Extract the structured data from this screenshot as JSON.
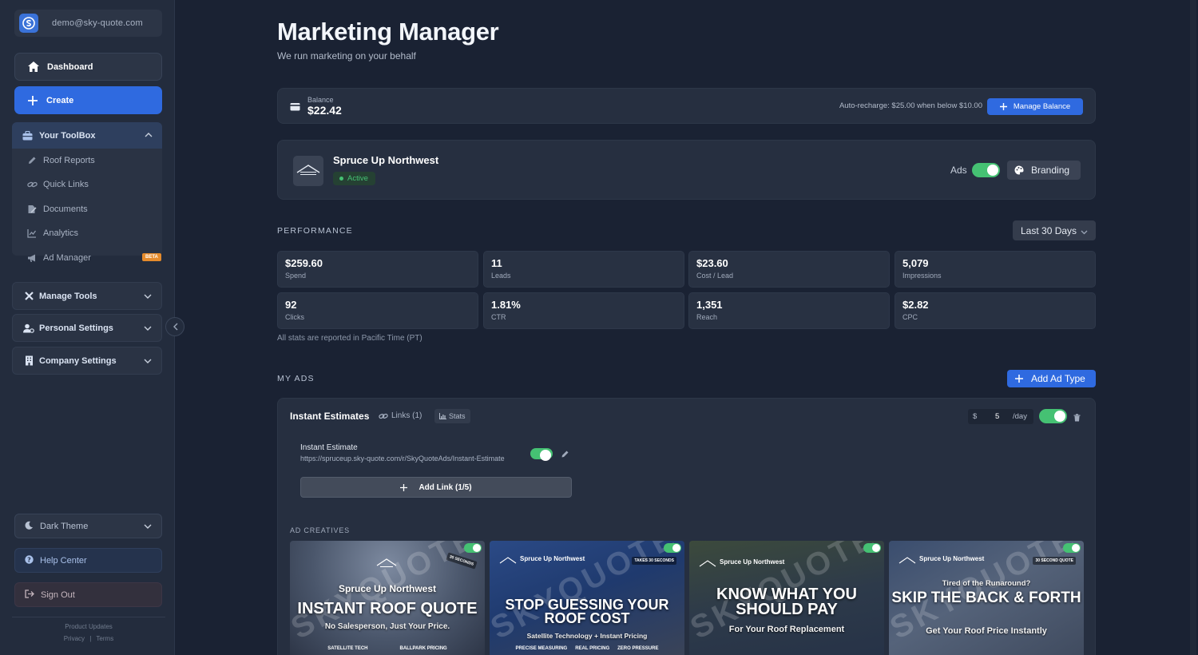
{
  "account": {
    "email": "demo@sky-quote.com",
    "logo_letter": "S"
  },
  "nav": {
    "dashboard": "Dashboard",
    "create": "Create"
  },
  "toolbox": {
    "title": "Your ToolBox",
    "items": [
      {
        "label": "Roof Reports",
        "icon": "pencil-icon"
      },
      {
        "label": "Quick Links",
        "icon": "link-icon"
      },
      {
        "label": "Documents",
        "icon": "document-icon"
      },
      {
        "label": "Analytics",
        "icon": "chart-icon"
      },
      {
        "label": "Ad Manager",
        "icon": "megaphone-icon"
      }
    ],
    "beta": "BETA"
  },
  "sections": {
    "manage_tools": "Manage Tools",
    "personal_settings": "Personal Settings",
    "company_settings": "Company Settings"
  },
  "footer_nav": {
    "theme": "Dark Theme",
    "help": "Help Center",
    "signout": "Sign Out",
    "product_updates": "Product Updates",
    "privacy": "Privacy",
    "separator": "|",
    "terms": "Terms"
  },
  "header": {
    "title": "Marketing Manager",
    "subtitle": "We run marketing on your behalf"
  },
  "balance": {
    "label": "Balance",
    "value": "$22.42",
    "auto_recharge": "Auto-recharge: $25.00 when below $10.00",
    "manage_label": "Manage Balance"
  },
  "company": {
    "name": "Spruce Up Northwest",
    "status": "Active",
    "ads_label": "Ads",
    "ads_enabled": true,
    "branding_label": "Branding"
  },
  "performance": {
    "label": "PERFORMANCE",
    "range": "Last 30 Days",
    "stats": [
      {
        "value": "$259.60",
        "label": "Spend"
      },
      {
        "value": "11",
        "label": "Leads"
      },
      {
        "value": "$23.60",
        "label": "Cost / Lead"
      },
      {
        "value": "5,079",
        "label": "Impressions"
      },
      {
        "value": "92",
        "label": "Clicks"
      },
      {
        "value": "1.81%",
        "label": "CTR"
      },
      {
        "value": "1,351",
        "label": "Reach"
      },
      {
        "value": "$2.82",
        "label": "CPC"
      }
    ],
    "note": "All stats are reported in Pacific Time (PT)"
  },
  "my_ads": {
    "label": "MY ADS",
    "add_label": "Add Ad Type",
    "ad_type": {
      "title": "Instant Estimates",
      "links_label": "Links (1)",
      "stats_label": "Stats",
      "budget_currency": "$",
      "budget_amount": "5",
      "budget_period": "/day",
      "enabled": true,
      "link": {
        "title": "Instant Estimate",
        "url": "https://spruceup.sky-quote.com/r/SkyQuoteAds/Instant-Estimate",
        "enabled": true
      },
      "add_link_label": "Add Link (1/5)",
      "creatives_label": "AD CREATIVES",
      "creatives": [
        {
          "brand": "Spruce Up Northwest",
          "badge": "30 SECONDS",
          "headline": "INSTANT ROOF QUOTE",
          "sub": "No Salesperson, Just Your Price.",
          "tags": [
            "SATELLITE TECH",
            "BALLPARK PRICING"
          ],
          "watermark": "SKYQUOTE"
        },
        {
          "brand": "Spruce Up Northwest",
          "badge": "TAKES 30 SECONDS",
          "headline": "STOP GUESSING YOUR ROOF COST",
          "sub": "Satellite Technology + Instant Pricing",
          "tags": [
            "PRECISE MEASURING",
            "REAL PRICING",
            "ZERO PRESSURE"
          ],
          "watermark": "SKYQUOTE"
        },
        {
          "brand": "Spruce Up Northwest",
          "badge": "",
          "headline": "KNOW WHAT YOU SHOULD PAY",
          "sub": "For Your Roof Replacement",
          "tags": [],
          "watermark": "SKYQUOTE"
        },
        {
          "brand": "Spruce Up Northwest",
          "badge": "30 SECOND QUOTE",
          "pre": "Tired of the Runaround?",
          "headline": "SKIP THE BACK & FORTH",
          "sub": "Get Your Roof Price Instantly",
          "tags": [],
          "watermark": "SKYQUOTE"
        }
      ]
    }
  },
  "colors": {
    "accent": "#2f6ae0",
    "success": "#45c173",
    "bg": "#1a2233",
    "sidebar": "#232c3d"
  }
}
